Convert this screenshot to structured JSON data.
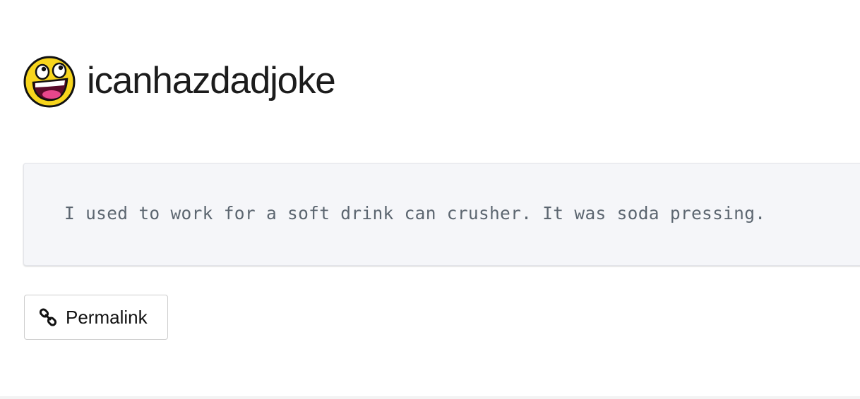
{
  "header": {
    "logo_icon": "awesome-face-icon",
    "site_title": "icanhazdadjoke"
  },
  "joke": {
    "text": "I used to work for a soft drink can crusher. It was soda pressing."
  },
  "actions": {
    "permalink_icon": "chain-link-icon",
    "permalink_label": "Permalink"
  },
  "colors": {
    "logo_yellow": "#f7d51d",
    "card_background": "#f5f6f9",
    "joke_text": "#5c6670"
  }
}
